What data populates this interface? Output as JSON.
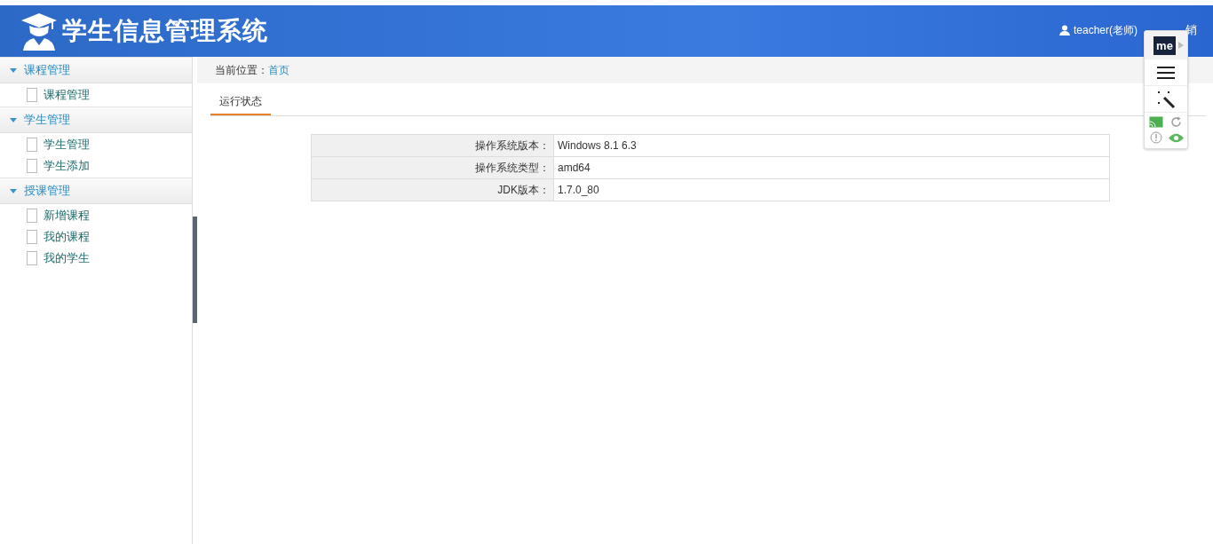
{
  "header": {
    "title": "学生信息管理系统",
    "user": "teacher(老师)",
    "logout": "销"
  },
  "sidebar": {
    "groups": [
      {
        "label": "课程管理",
        "expanded": true,
        "items": [
          {
            "label": "课程管理"
          }
        ]
      },
      {
        "label": "学生管理",
        "expanded": true,
        "items": [
          {
            "label": "学生管理"
          },
          {
            "label": "学生添加"
          }
        ]
      },
      {
        "label": "授课管理",
        "expanded": true,
        "items": [
          {
            "label": "新增课程"
          },
          {
            "label": "我的课程"
          },
          {
            "label": "我的学生"
          }
        ]
      }
    ]
  },
  "breadcrumb": {
    "label": "当前位置：",
    "link": "首页"
  },
  "tabs": [
    {
      "label": "运行状态",
      "selected": true
    }
  ],
  "info_table": {
    "rows": [
      {
        "label": "操作系统版本：",
        "value": "Windows 8.1  6.3"
      },
      {
        "label": "操作系统类型：",
        "value": "amd64"
      },
      {
        "label": "JDK版本：",
        "value": "1.7.0_80"
      }
    ]
  },
  "extension_panel": {
    "logo": "me"
  }
}
